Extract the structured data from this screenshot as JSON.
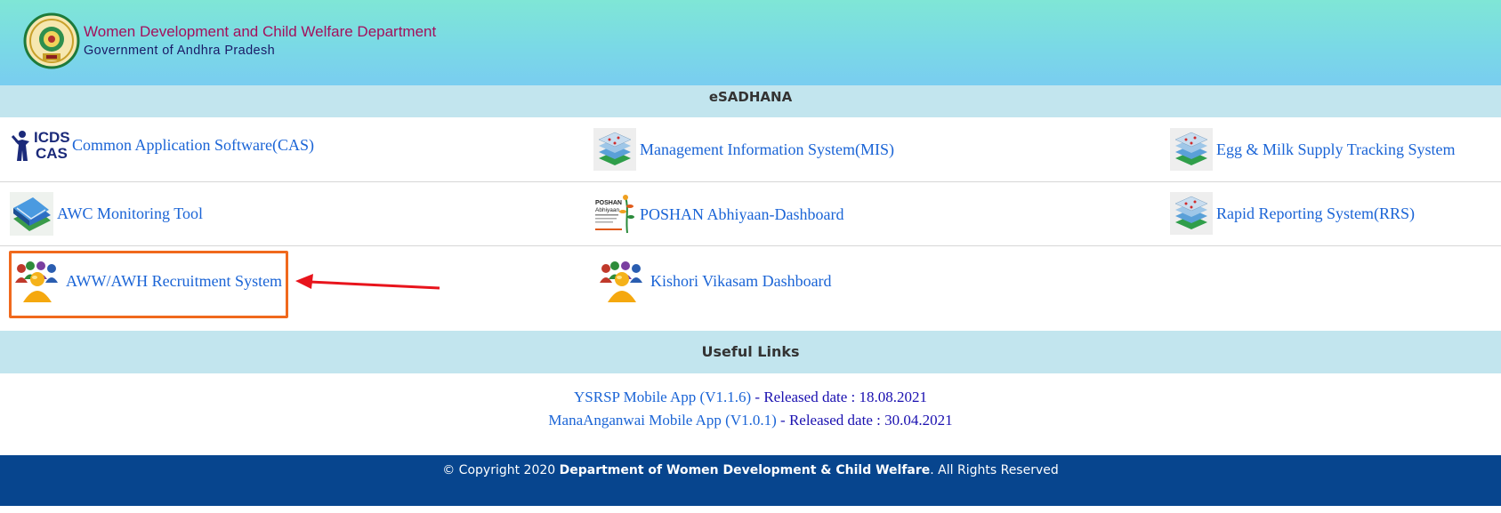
{
  "header": {
    "title": "Women Development and Child Welfare Department",
    "subtitle": "Government of Andhra Pradesh",
    "emblem_icon": "ap-state-emblem-icon"
  },
  "esadhana": {
    "heading": "eSADHANA",
    "items": [
      {
        "label": "Common Application Software(CAS)",
        "icon": "icds-cas-logo-icon"
      },
      {
        "label": "Management Information System(MIS)",
        "icon": "layered-map-icon"
      },
      {
        "label": "Egg & Milk Supply Tracking System",
        "icon": "layered-map-icon"
      },
      {
        "label": "AWC Monitoring Tool",
        "icon": "book-stack-icon"
      },
      {
        "label": "POSHAN Abhiyaan-Dashboard",
        "icon": "poshan-abhiyaan-logo-icon"
      },
      {
        "label": "Rapid Reporting System(RRS)",
        "icon": "layered-map-icon"
      },
      {
        "label": "AWW/AWH Recruitment System",
        "icon": "people-group-icon"
      },
      {
        "label": "Kishori Vikasam Dashboard",
        "icon": "people-group-icon"
      }
    ]
  },
  "useful_links": {
    "heading": "Useful Links",
    "links": [
      {
        "link_text": "YSRSP Mobile App (V1.1.6)",
        "suffix": " - Released date : 18.08.2021"
      },
      {
        "link_text": "ManaAnganwai Mobile App (V1.0.1)",
        "suffix": " - Released date : 30.04.2021"
      }
    ]
  },
  "footer": {
    "prefix": "© Copyright 2020 ",
    "org": "Department of Women Development & Child Welfare",
    "suffix": ". All Rights Reserved"
  },
  "annotation": {
    "highlight_color": "#f0691d",
    "arrow_color": "#e8141c"
  },
  "colors": {
    "link": "#1a64d6",
    "section_bar": "#c2e5ee",
    "footer_bg": "#07458e",
    "title": "#a3105c"
  }
}
